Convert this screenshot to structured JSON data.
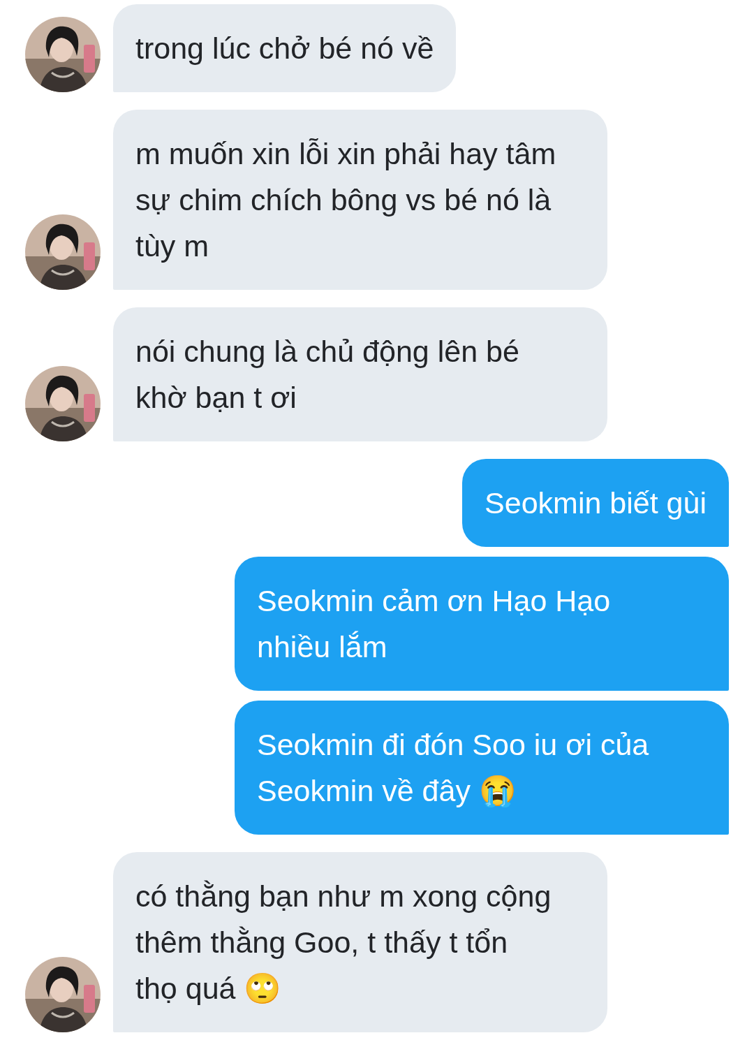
{
  "messages": [
    {
      "kind": "received",
      "text": "trong lúc chở bé nó về",
      "avatar": true
    },
    {
      "kind": "received",
      "text": "m muốn xin lỗi xin phải hay tâm\nsự chim chích bông vs bé nó là\ntùy m",
      "avatar": true
    },
    {
      "kind": "received",
      "text": "nói chung là chủ động lên bé\nkhờ bạn t ơi",
      "avatar": true
    },
    {
      "kind": "sent",
      "text": "Seokmin biết gùi"
    },
    {
      "kind": "sent",
      "text": "Seokmin cảm ơn Hạo Hạo\nnhiều lắm"
    },
    {
      "kind": "sent",
      "text": "Seokmin đi đón Soo iu ơi của\nSeokmin về đây 😭"
    },
    {
      "kind": "received",
      "text": "có thằng bạn như m xong cộng\nthêm thằng Goo, t thấy t tổn\nthọ quá 🙄",
      "avatar": true
    }
  ]
}
